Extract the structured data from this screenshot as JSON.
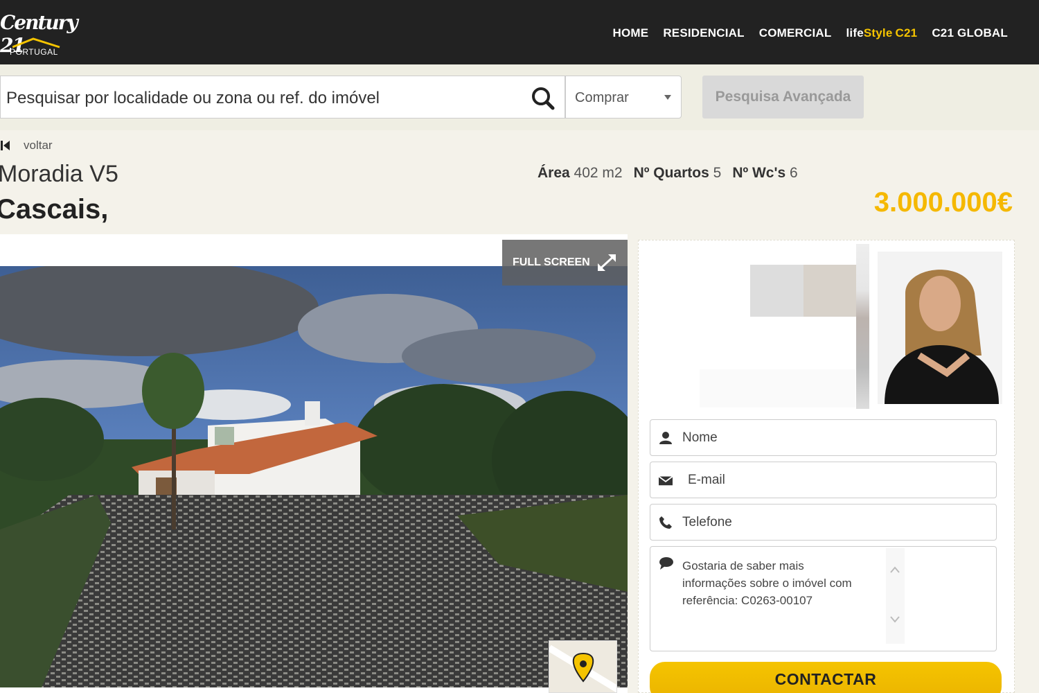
{
  "brand": {
    "logo_text": "Century 21",
    "sub": "PORTUGAL"
  },
  "nav": {
    "home": "HOME",
    "residencial": "RESIDENCIAL",
    "comercial": "COMERCIAL",
    "lifestyle_a": "life",
    "lifestyle_b": "Style",
    "lifestyle_c": "C21",
    "global": "C21 GLOBAL"
  },
  "search": {
    "placeholder": "Pesquisar por localidade ou zona ou ref. do imóvel",
    "select_value": "Comprar",
    "advanced_label": "Pesquisa Avançada"
  },
  "listing": {
    "back_label": "voltar",
    "type": "Moradia V5",
    "location": "Cascais,",
    "area_label": "Área",
    "area_value": "402 m2",
    "rooms_label": "Nº Quartos",
    "rooms_value": "5",
    "wc_label": "Nº Wc's",
    "wc_value": "6",
    "price": "3.000.000€"
  },
  "gallery": {
    "fullscreen_label": "FULL SCREEN"
  },
  "contact_form": {
    "name_placeholder": "Nome",
    "email_placeholder": "E-mail",
    "phone_placeholder": "Telefone",
    "message": "Gostaria de saber mais informações sobre o imóvel com referência: C0263-00107",
    "submit_label": "CONTACTAR"
  },
  "colors": {
    "accent": "#f5c400",
    "header_bg": "#222222",
    "price": "#f5b800"
  },
  "icons": [
    "search-icon",
    "dropdown-arrow-icon",
    "back-icon",
    "expand-icon",
    "map-pin-icon",
    "user-icon",
    "envelope-icon",
    "phone-icon",
    "speech-bubble-icon",
    "chevron-up-icon",
    "chevron-down-icon"
  ]
}
